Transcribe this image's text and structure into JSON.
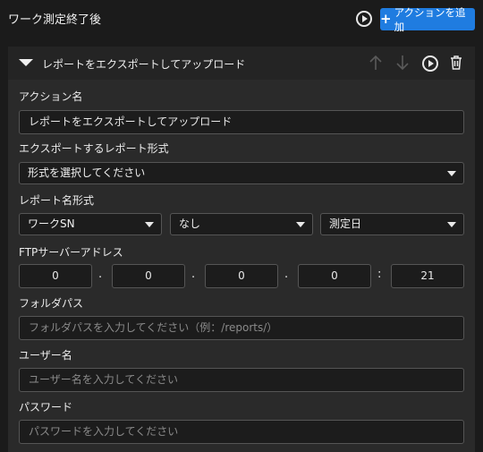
{
  "header": {
    "title": "ワーク測定終了後",
    "add_action_label": "アクションを追加"
  },
  "action": {
    "title": "レポートをエクスポートしてアップロード",
    "fields": {
      "action_name_label": "アクション名",
      "action_name_value": "レポートをエクスポートしてアップロード",
      "export_format_label": "エクスポートするレポート形式",
      "export_format_value": "形式を選択してください",
      "report_name_label": "レポート名形式",
      "report_name_parts": [
        "ワークSN",
        "なし",
        "測定日"
      ],
      "ftp_label": "FTPサーバーアドレス",
      "ftp_ip": [
        "0",
        "0",
        "0",
        "0"
      ],
      "ftp_port": "21",
      "ip_separators": [
        ".",
        ".",
        ".",
        ":"
      ],
      "folder_label": "フォルダパス",
      "folder_placeholder": "フォルダパスを入力してください（例：/reports/）",
      "user_label": "ユーザー名",
      "user_placeholder": "ユーザー名を入力してください",
      "password_label": "パスワード",
      "password_placeholder": "パスワードを入力してください"
    }
  },
  "colors": {
    "accent": "#1f7ce0",
    "background": "#1b1b1b",
    "card": "#2a2a2a"
  },
  "icons": [
    "play-icon",
    "plus-icon",
    "collapse-caret-icon",
    "arrow-up-icon",
    "arrow-down-icon",
    "trash-icon",
    "dropdown-arrow-icon"
  ]
}
